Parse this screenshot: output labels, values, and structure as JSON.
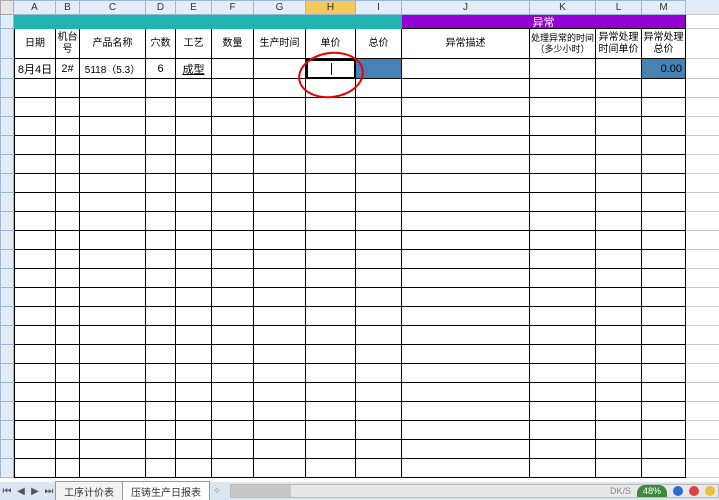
{
  "columns": [
    "A",
    "B",
    "C",
    "D",
    "E",
    "F",
    "G",
    "H",
    "I",
    "J",
    "K",
    "L",
    "M"
  ],
  "active_column": "H",
  "top_bands": {
    "exception_label": "异常"
  },
  "headers": {
    "A": "日期",
    "B_line1": "机台",
    "B_line2": "号",
    "C": "产品名称",
    "D": "穴数",
    "E": "工艺",
    "F": "数量",
    "G": "生产时间",
    "H": "单价",
    "I": "总价",
    "J": "异常描述",
    "K_line1": "处理异常的时间",
    "K_line2": "（多少小时）",
    "L_line1": "异常处理",
    "L_line2": "时间单价",
    "M_line1": "异常处理",
    "M_line2": "总价"
  },
  "row": {
    "date": "8月4日",
    "machine": "2#",
    "product": "5118（5.3）",
    "cavity": "6",
    "process": "成型",
    "qty": "",
    "prod_time": "",
    "unit_price": "",
    "total": "",
    "exc_desc": "",
    "exc_time": "",
    "exc_unit": "",
    "exc_total": "0.00"
  },
  "tabs": {
    "t1": "工序计价表",
    "t2": "压铸生产日报表"
  },
  "zoom": "48%",
  "footer_label": "DK/S"
}
